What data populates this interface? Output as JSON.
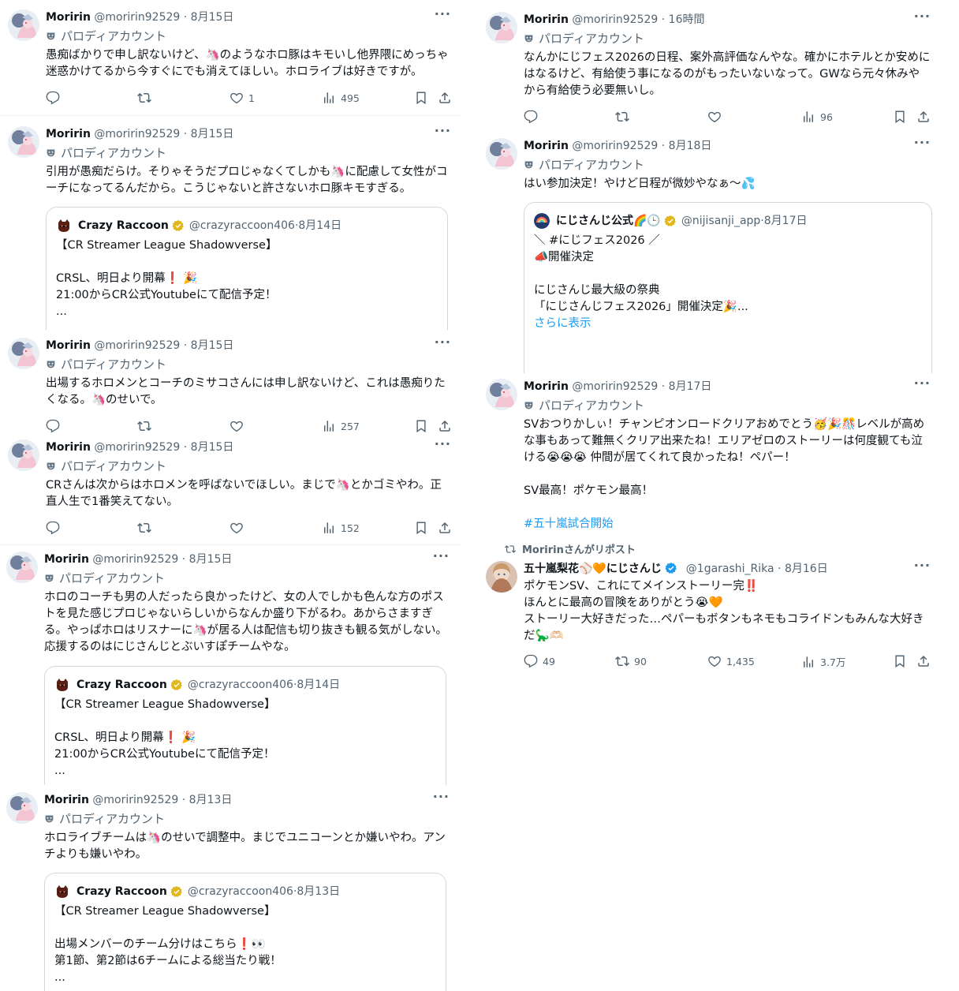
{
  "colors": {
    "accent": "#1d9bf0",
    "text": "#0f1419",
    "muted": "#536471",
    "border": "#cfd9de",
    "verified_gold": "#e2b719"
  },
  "icons": {
    "reply": "reply-icon",
    "repost": "repost-icon",
    "like": "heart-icon",
    "views": "views-icon",
    "bookmark": "bookmark-icon",
    "share": "share-icon",
    "more": "more-icon",
    "verified": "verified-badge-icon",
    "parody": "parody-mask-icon"
  },
  "common": {
    "more": "···",
    "parody_label": "パロディアカウント",
    "separator": "·"
  },
  "left": [
    {
      "name": "Moririn",
      "handle": "@moririn92529",
      "time": "8月15日",
      "text": "愚痴ばかりで申し訳ないけど、🦄のようなホロ豚はキモいし他界隈にめっちゃ迷惑かけてるから今すぐにでも消えてほしい。ホロライブは好きですが。",
      "replies": "",
      "reposts": "",
      "likes": "1",
      "views": "495"
    },
    {
      "name": "Moririn",
      "handle": "@moririn92529",
      "time": "8月15日",
      "text": "引用が愚痴だらけ。そりゃそうだプロじゃなくてしかも🦄に配慮して女性がコーチになってるんだから。こうじゃないと許さないホロ豚キモすぎる。",
      "quote": {
        "name": "Crazy Raccoon",
        "handle": "@crazyraccoon406",
        "time": "8月14日",
        "text": "【CR Streamer League Shadowverse】\n\nCRSL、明日より開幕❗ 🎉\n21:00からCR公式Youtubeにて配信予定！\n..."
      }
    },
    {
      "name": "Moririn",
      "handle": "@moririn92529",
      "time": "8月15日",
      "text": "出場するホロメンとコーチのミサコさんには申し訳ないけど、これは愚痴りたくなる。🦄のせいで。",
      "replies": "",
      "reposts": "",
      "likes": "",
      "views": "257"
    },
    {
      "name": "Moririn",
      "handle": "@moririn92529",
      "time": "8月15日",
      "text": "CRさんは次からはホロメンを呼ばないでほしい。まじで🦄とかゴミやわ。正直人生で1番笑えてない。",
      "replies": "",
      "reposts": "",
      "likes": "",
      "views": "152"
    },
    {
      "name": "Moririn",
      "handle": "@moririn92529",
      "time": "8月15日",
      "text": "ホロのコーチも男の人だったら良かったけど、女の人でしかも色んな方のポストを見た感じプロじゃないらしいからなんか盛り下がるわ。あからさますぎる。やっぱホロはリスナーに🦄が居る人は配信も切り抜きも観る気がしない。応援するのはにじさんじとぶいすぽチームやな。",
      "quote": {
        "name": "Crazy Raccoon",
        "handle": "@crazyraccoon406",
        "time": "8月14日",
        "text": "【CR Streamer League Shadowverse】\n\nCRSL、明日より開幕❗ 🎉\n21:00からCR公式Youtubeにて配信予定！\n..."
      }
    },
    {
      "name": "Moririn",
      "handle": "@moririn92529",
      "time": "8月13日",
      "text": "ホロライブチームは🦄のせいで調整中。まじでユニコーンとか嫌いやわ。アンチよりも嫌いやわ。",
      "quote": {
        "name": "Crazy Raccoon",
        "handle": "@crazyraccoon406",
        "time": "8月13日",
        "text": "【CR Streamer League Shadowverse】\n\n出場メンバーのチーム分けはこちら❗👀\n第1節、第2節は6チームによる総当たり戦！\n..."
      }
    }
  ],
  "right": [
    {
      "name": "Moririn",
      "handle": "@moririn92529",
      "time": "16時間",
      "text": "なんかにじフェス2026の日程、案外高評価なんやな。確かにホテルとか安めにはなるけど、有給使う事になるのがもったいないなって。GWなら元々休みやから有給使う必要無いし。",
      "replies": "",
      "reposts": "",
      "likes": "",
      "views": "96"
    },
    {
      "name": "Moririn",
      "handle": "@moririn92529",
      "time": "8月18日",
      "text": "はい参加決定！やけど日程が微妙やなぁ～💦",
      "quote": {
        "name": "にじさんじ公式🌈🕒",
        "handle": "@nijisanji_app",
        "time": "8月17日",
        "text": "＼ #にじフェス2026 ／\n📣開催決定\n\nにじさんじ最大級の祭典\n「にじさんじフェス2026」開催決定🎉...",
        "show_more": "さらに表示"
      }
    },
    {
      "name": "Moririn",
      "handle": "@moririn92529",
      "time": "8月17日",
      "text": "SVおつりかしぃ！チャンピオンロードクリアおめでとう🥳🎉🎊レベルが高めな事もあって難無くクリア出来たね！エリアゼロのストーリーは何度観ても泣ける😭😭😭 仲間が居てくれて良かったね！ペパー！\n\nSV最高！ポケモン最高！",
      "hashtag": "#五十嵐試合開始"
    },
    {
      "repost_label": "Moririnさんがリポスト",
      "name": "五十嵐梨花⚾🧡にじさんじ",
      "handle": "@1garashi_Rika",
      "time": "8月16日",
      "text": "ポケモンSV、これにてメインストーリー完‼️\nほんとに最高の冒険をありがとう😭🧡\nストーリー大好きだった…ペパーもボタンもネモもコライドンもみんな大好きだ🦕🫶🏻",
      "replies": "49",
      "reposts": "90",
      "likes": "1,435",
      "views": "3.7万"
    }
  ]
}
